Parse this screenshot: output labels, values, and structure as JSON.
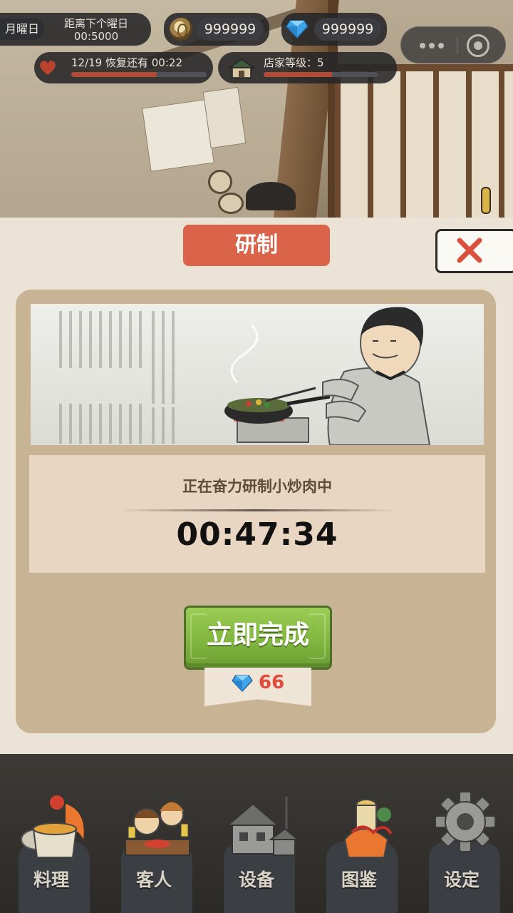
{
  "hud": {
    "day_name": "月曜日",
    "next_day_label": "距离下个曜日",
    "next_day_countdown": "00:5000",
    "coins": "999999",
    "gems": "999999",
    "energy_text": "12/19 恢复还有 00:22",
    "energy_fraction": 0.63,
    "shop_level_text": "店家等级：5",
    "shop_level_fraction": 0.6
  },
  "panel": {
    "title": "研制",
    "status_text": "正在奋力研制小炒肉中",
    "timer": "00:47:34",
    "finish_button": "立即完成",
    "finish_cost": "66"
  },
  "nav": {
    "items": [
      {
        "label": "料理",
        "icon": "cooking-icon"
      },
      {
        "label": "客人",
        "icon": "guests-icon"
      },
      {
        "label": "设备",
        "icon": "equipment-icon"
      },
      {
        "label": "图鉴",
        "icon": "encyclopedia-icon"
      },
      {
        "label": "设定",
        "icon": "gear-icon"
      }
    ]
  },
  "colors": {
    "title_tab": "#d9644a",
    "finish_button": "#7fb43e",
    "cost_text": "#e24a3b",
    "panel_bg": "#ebe3d6",
    "inner_bg": "#c8b394"
  }
}
